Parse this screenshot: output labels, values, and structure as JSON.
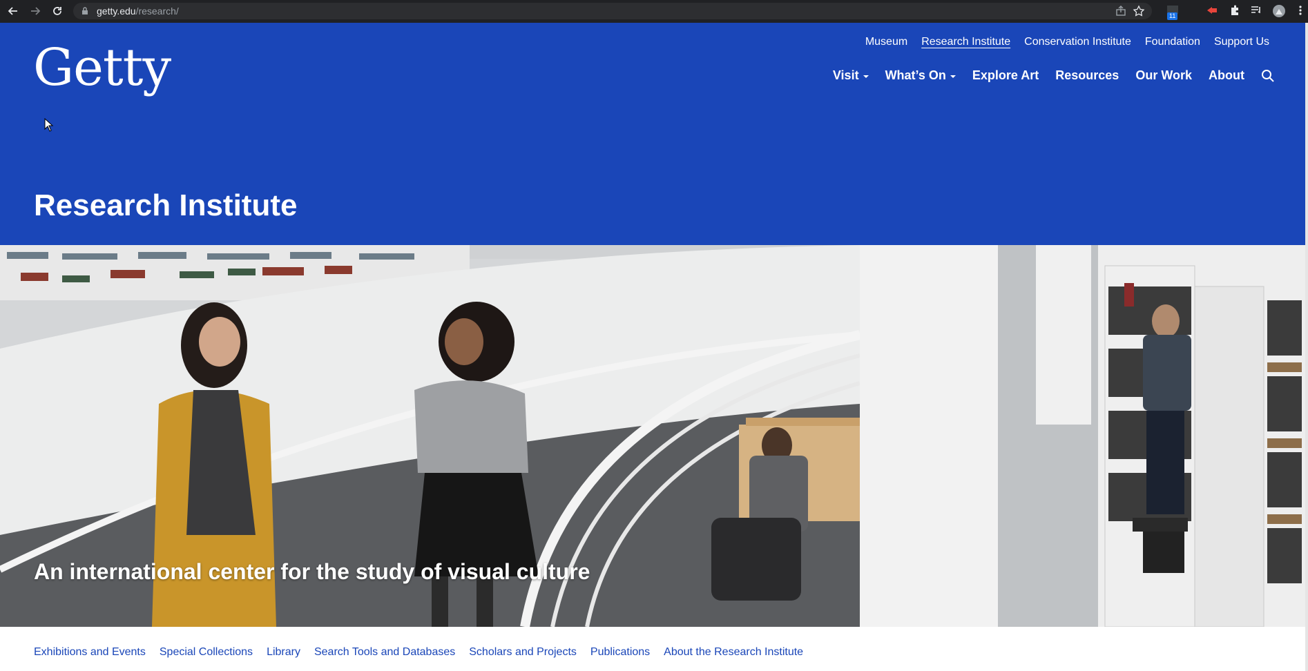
{
  "browser": {
    "url_host": "getty.edu",
    "url_path": "/research/",
    "extension_badge": "11"
  },
  "colors": {
    "brand_blue": "#1a46b8",
    "link_blue": "#1a46b8"
  },
  "header": {
    "logo_text": "Getty",
    "top_links": [
      "Museum",
      "Research Institute",
      "Conservation Institute",
      "Foundation",
      "Support Us"
    ],
    "current_top_link": "Research Institute",
    "nav": {
      "visit": "Visit",
      "whats_on": "What’s On",
      "explore_art": "Explore Art",
      "resources": "Resources",
      "our_work": "Our Work",
      "about": "About"
    }
  },
  "page": {
    "title": "Research Institute",
    "tagline": "An international center for the study of visual culture"
  },
  "sub_nav": {
    "items": [
      "Exhibitions and Events",
      "Special Collections",
      "Library",
      "Search Tools and Databases",
      "Scholars and Projects",
      "Publications",
      "About the Research Institute"
    ]
  }
}
